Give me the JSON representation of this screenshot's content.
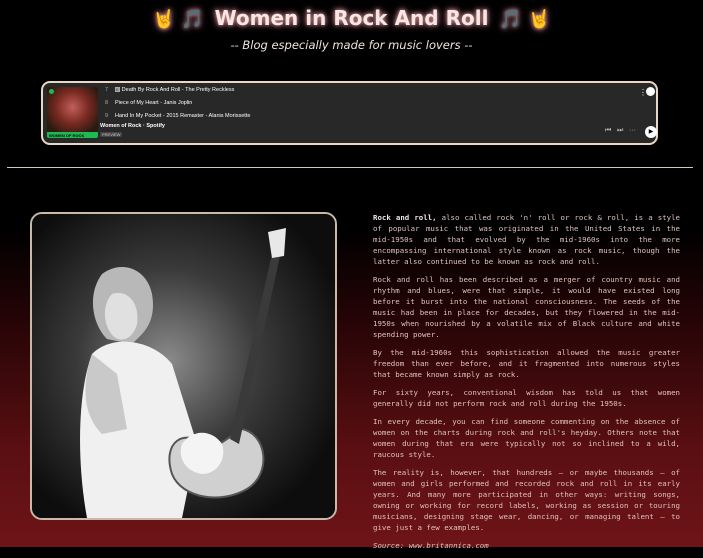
{
  "header": {
    "title": "Women in Rock And Roll",
    "emoji_left": "🤘 🎵",
    "emoji_right": "🎵 🤘",
    "subtitle": "-- Blog especially made for music lovers --"
  },
  "player": {
    "tracks": [
      {
        "num": "7",
        "explicit": "E",
        "title": "Death By Rock And Roll - The Pretty Reckless"
      },
      {
        "num": "8",
        "title": "Piece of My Heart - Janis Joplin"
      },
      {
        "num": "9",
        "title": "Hand In My Pocket - 2015 Remaster - Alanis Morissette"
      }
    ],
    "playlist_name": "Women of Rock · Spotify",
    "cover_label": "WOMEN OF ROCK",
    "preview_label": "PREVIEW",
    "colors": {
      "accent": "#1db954",
      "background": "#282828"
    }
  },
  "article": {
    "lead_bold": "Rock and roll,",
    "p1": " also called rock 'n' roll or rock & roll, is a style of popular music that was originated in the United States in the mid-1950s and that evolved by the mid-1960s into the more encompassing international style known as rock music, though the latter also continued to be known as rock and roll.",
    "p2": "Rock and roll has been described as a merger of country music and rhythm and blues, were that simple, it would have existed long before it burst into the national consciousness. The seeds of the music had been in place for decades, but they flowered in the mid-1950s when nourished by a volatile mix of Black culture and white spending power.",
    "p3": "By the mid-1960s this sophistication allowed the music greater freedom than ever before, and it fragmented into numerous styles that became known simply as rock.",
    "p4": "For sixty years, conventional wisdom has told us that women generally did not perform rock and roll during the 1950s.",
    "p5": "In every decade, you can find someone commenting on the absence of women on the charts during rock and roll's heyday. Others note that women during that era were typically not so inclined to a wild, raucous style.",
    "p6": "The reality is, however, that hundreds – or maybe thousands – of women and girls performed and recorded rock and roll in its early years. And many more participated in other ways: writing songs, owning or working for record labels, working as session or touring musicians, designing stage wear, dancing, or managing talent – to give just a few examples.",
    "source": "Source: www.britannica.com"
  }
}
